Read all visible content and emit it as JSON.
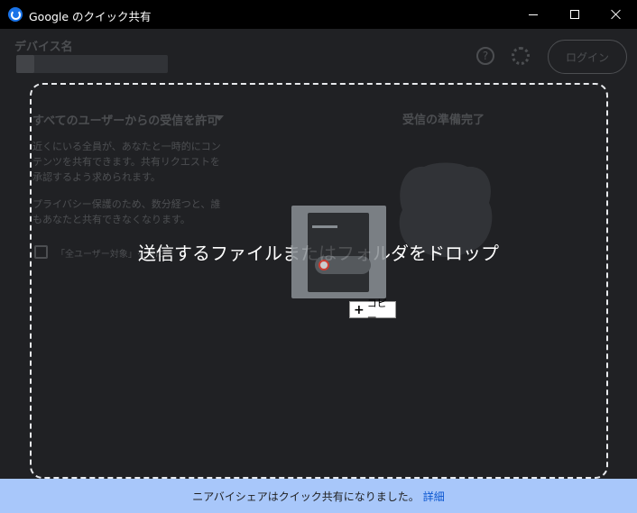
{
  "window": {
    "title": "Google のクイック共有",
    "icon": "quick-share-icon"
  },
  "background": {
    "device_label": "デバイス名",
    "login_label": "ログイン",
    "receive_setting": "すべてのユーザーからの受信を許可",
    "description_1": "近くにいる全員が、あなたと一時的にコンテンツを共有できます。共有リクエストを承認するよう求められます。",
    "description_2": "プライバシー保護のため、数分経つと、誰もあなたと共有できなくなります。",
    "checkbox_label": "「全ユーザー対象」を常に",
    "ready_status": "受信の準備完了"
  },
  "dropzone": {
    "message": "送信するファイルまたはフォルダをドロップ"
  },
  "drag": {
    "copy_label": "コピー"
  },
  "banner": {
    "text": "ニアバイシェアはクイック共有になりました。",
    "link": "詳細"
  },
  "colors": {
    "background": "#202124",
    "titlebar": "#000000",
    "banner": "#a8c7fa",
    "link": "#0b57d0"
  }
}
